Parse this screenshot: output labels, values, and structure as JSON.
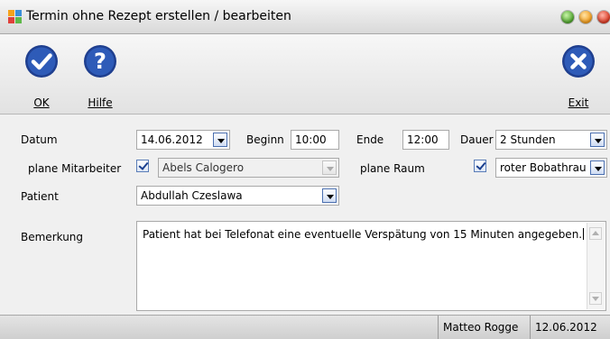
{
  "window": {
    "title": "Termin ohne Rezept erstellen / bearbeiten",
    "controls": [
      "minimize-button",
      "maximize-button",
      "close-button"
    ]
  },
  "toolbar": {
    "ok_label": "OK",
    "help_label": "Hilfe",
    "exit_label": "Exit"
  },
  "form": {
    "datum_label": "Datum",
    "datum_value": "14.06.2012",
    "beginn_label": "Beginn",
    "beginn_value": "10:00",
    "ende_label": "Ende",
    "ende_value": "12:00",
    "dauer_label": "Dauer",
    "dauer_value": "2 Stunden",
    "mitarbeiter_label": "plane Mitarbeiter",
    "mitarbeiter_checked": true,
    "mitarbeiter_value": "Abels Calogero",
    "raum_label": "plane Raum",
    "raum_checked": true,
    "raum_value": "roter Bobathrau",
    "patient_label": "Patient",
    "patient_value": "Abdullah Czeslawa",
    "bemerkung_label": "Bemerkung",
    "bemerkung_value": "Patient hat bei Telefonat eine eventuelle Verspätung von 15 Minuten angegeben."
  },
  "statusbar": {
    "user": "Matteo Rogge",
    "date": "12.06.2012"
  },
  "colors": {
    "icon_blue": "#1f3f8f",
    "dropdown_border": "#4a6fb0"
  }
}
